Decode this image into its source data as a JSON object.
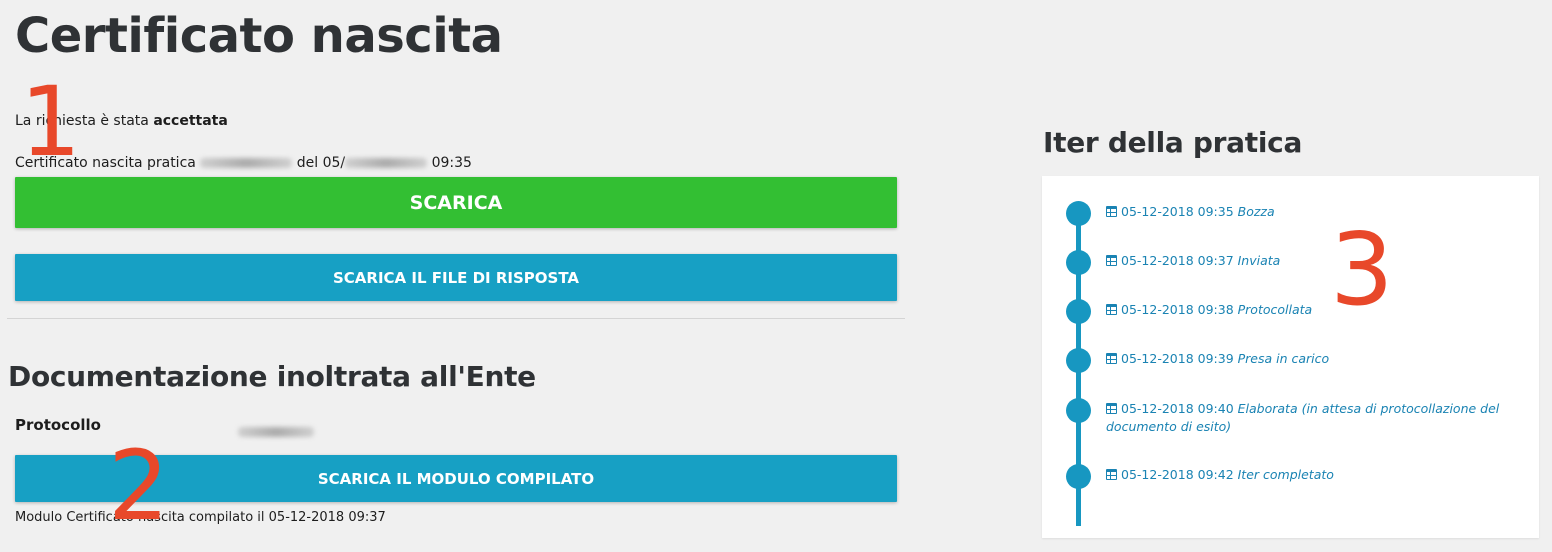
{
  "page": {
    "title": "Certificato nascita"
  },
  "status": {
    "prefix": "La richiesta è stata ",
    "state": "accettata"
  },
  "practice": {
    "prefix": "Certificato nascita pratica ",
    "middle": " del 05/",
    "suffix": " 09:35"
  },
  "actions": {
    "download_label": "SCARICA",
    "download_reply_label": "SCARICA IL FILE DI RISPOSTA",
    "download_module_label": "SCARICA IL MODULO COMPILATO"
  },
  "documentation": {
    "title": "Documentazione inoltrata all'Ente",
    "protocol_label": "Protocollo",
    "module_note": "Modulo Certificato nascita compilato il 05-12-2018 09:37"
  },
  "annotations": {
    "marker_1": "1",
    "marker_2": "2",
    "marker_3": "3"
  },
  "iter": {
    "title": "Iter della pratica",
    "steps": [
      {
        "datetime": "05-12-2018 09:35",
        "status": "Bozza"
      },
      {
        "datetime": "05-12-2018 09:37",
        "status": "Inviata"
      },
      {
        "datetime": "05-12-2018 09:38",
        "status": "Protocollata"
      },
      {
        "datetime": "05-12-2018 09:39",
        "status": "Presa in carico"
      },
      {
        "datetime": "05-12-2018 09:40",
        "status": "Elaborata (in attesa di protocollazione del documento di esito)"
      },
      {
        "datetime": "05-12-2018 09:42",
        "status": "Iter completato"
      }
    ]
  },
  "colors": {
    "primary_blue": "#17a0c4",
    "success_green": "#33bf33",
    "annotation_red": "#e8482a",
    "link_blue": "#1a83b3"
  }
}
